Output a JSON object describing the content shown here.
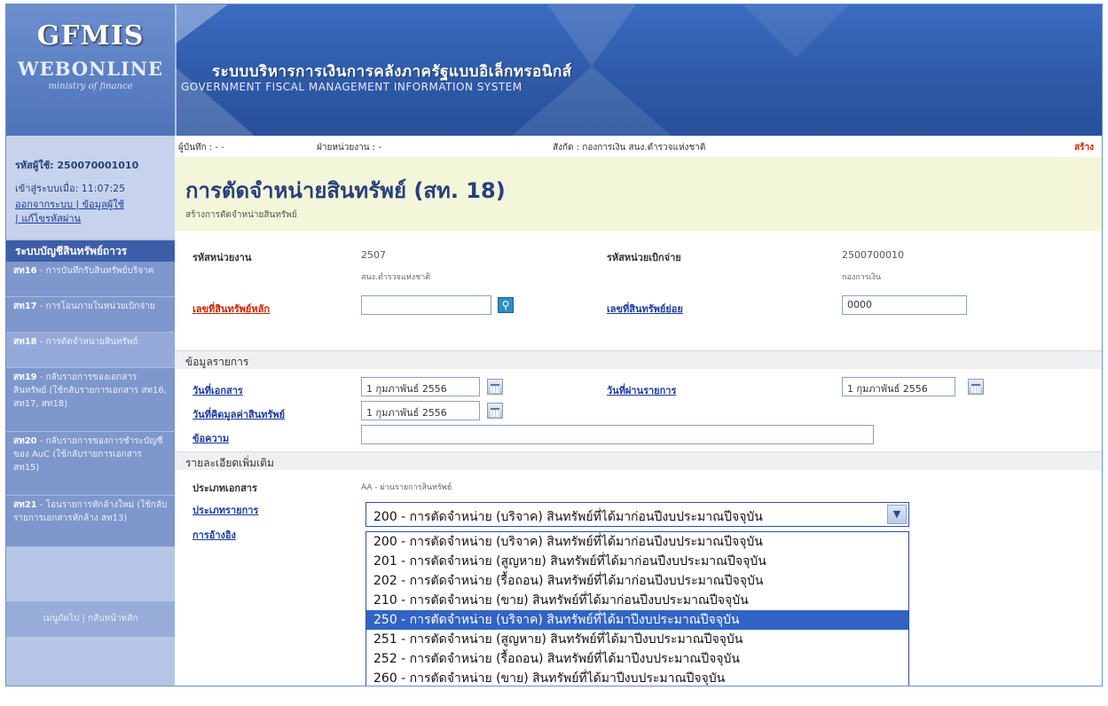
{
  "header": {
    "logo_title": "GFMIS",
    "logo_sub": "WEBONLINE",
    "logo_ministry": "ministry of finance",
    "system_thai": "ระบบบริหารการเงินการคลังภาครัฐแบบอิเล็กทรอนิกส์",
    "system_english": "GOVERNMENT FISCAL MANAGEMENT INFORMATION SYSTEM"
  },
  "sidebar": {
    "user_id": "รหัสผู้ใช้: 250070001010",
    "login_time": "เข้าสู่ระบบเมื่อ: 11:07:25",
    "link_logout": "ออกจากระบบ | ข้อมูลผู้ใช้",
    "link_change_password": "| แก้ไขรหัสผ่าน",
    "menu_title": "ระบบบัญชีสินทรัพย์ถาวร",
    "items": [
      {
        "code": "สท16",
        "label": "- การบันทึกรับสินทรัพย์บริจาค"
      },
      {
        "code": "สท17",
        "label": "- การโอนภายในหน่วยเบิกจ่าย"
      },
      {
        "code": "สท18",
        "label": "- การตัดจำหน่ายสินทรัพย์"
      },
      {
        "code": "สท19",
        "label": "- กลับรายการของเอกสารสินทรัพย์ (ใช้กลับรายการเอกสาร สท16, สท17, สท18)"
      },
      {
        "code": "สท20",
        "label": "- กลับรายการของการชำระบัญชีของ AuC (ใช้กลับรายการเอกสาร สท15)"
      },
      {
        "code": "สท21",
        "label": "- โอนรายการหักล้างใหม่ (ใช้กลับรายการเอกสารหักล้าง สท13)"
      }
    ],
    "footer_link": "เมนูถัดไป | กลับหน้าหลัก"
  },
  "topbar": {
    "recorder": "ผู้บันทึก : - -",
    "division": "ฝ่ายหน่วยงาน : -",
    "affiliation": "สังกัด : กองการเงิน สนง.ตำรวจแห่งชาติ",
    "create": "สร้าง"
  },
  "page": {
    "title": "การตัดจำหน่ายสินทรัพย์ (สท. 18)",
    "subtitle": "สร้างการตัดจำหน่ายสินทรัพย์"
  },
  "form": {
    "agency_code_label": "รหัสหน่วยงาน",
    "agency_code_value": "2507",
    "agency_name": "สนง.ตำรวจแห่งชาติ",
    "disbursement_code_label": "รหัสหน่วยเบิกจ่าย",
    "disbursement_code_value": "2500700010",
    "disbursement_name": "กองการเงิน",
    "main_asset_label": "เลขที่สินทรัพย์หลัก",
    "main_asset_value": "",
    "sub_asset_label": "เลขที่สินทรัพย์ย่อย",
    "sub_asset_value": "0000",
    "section_items": "ข้อมูลรายการ",
    "doc_date_label": "วันที่เอกสาร",
    "doc_date_value": "1 กุมภาพันธ์ 2556",
    "post_date_label": "วันที่ผ่านรายการ",
    "post_date_value": "1 กุมภาพันธ์ 2556",
    "value_date_label": "วันที่คิดมูลค่าสินทรัพย์",
    "value_date_value": "1 กุมภาพันธ์ 2556",
    "text_label": "ข้อความ",
    "text_value": "",
    "section_details": "รายละเอียดเพิ่มเติม",
    "doc_type_label": "ประเภทเอกสาร",
    "doc_type_value": "AA - ผ่านรายการสินทรัพย์",
    "trans_type_label": "ประเภทรายการ",
    "reference_label": "การอ้างอิง"
  },
  "transaction_select": {
    "selected": "200 - การตัดจำหน่าย (บริจาค) สินทรัพย์ที่ได้มาก่อนปีงบประมาณปีจจุบัน",
    "options": [
      "200 - การตัดจำหน่าย (บริจาค) สินทรัพย์ที่ได้มาก่อนปีงบประมาณปีจจุบัน",
      "201 - การตัดจำหน่าย (สูญหาย) สินทรัพย์ที่ได้มาก่อนปีงบประมาณปีจจุบัน",
      "202 - การตัดจำหน่าย (รื้อถอน) สินทรัพย์ที่ได้มาก่อนปีงบประมาณปีจจุบัน",
      "210 - การตัดจำหน่าย (ขาย) สินทรัพย์ที่ได้มาก่อนปีงบประมาณปีจจุบัน",
      "250 - การตัดจำหน่าย (บริจาค) สินทรัพย์ที่ได้มาปีงบประมาณปีจจุบัน",
      "251 - การตัดจำหน่าย (สูญหาย) สินทรัพย์ที่ได้มาปีงบประมาณปีจจุบัน",
      "252 - การตัดจำหน่าย (รื้อถอน) สินทรัพย์ที่ได้มาปีงบประมาณปีจจุบัน",
      "260 - การตัดจำหน่าย (ขาย) สินทรัพย์ที่ได้มาปีงบประมาณปีจจุบัน"
    ],
    "highlighted_index": 4
  },
  "colors": {
    "header_blue": "#2f5aa8",
    "sidebar_bg": "#b6c6e6",
    "title_bg": "#f4f6da",
    "link_blue": "#1a3aa0",
    "link_red": "#cc2200",
    "highlight": "#3164c4"
  }
}
